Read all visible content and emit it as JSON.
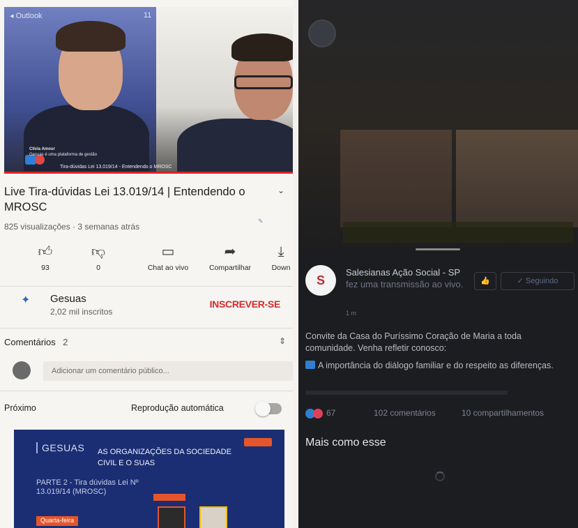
{
  "youtube": {
    "video": {
      "status_app": "◂ Outlook",
      "time": "11",
      "caption_name": "Clívia Amour",
      "caption_text": "Gesuas é uma plataforma de gestão",
      "subtitle": "Tira-dúvidas Lei 13.019/14 - Entendendo o MROSC",
      "progress": 1.0
    },
    "title": "Live Tira-dúvidas Lei 13.019/14 | Entendendo o MROSC",
    "meta": "825 visualizações · 3 semanas atrás",
    "actions": [
      {
        "icon": "thumb-up-icon",
        "glyph": "👍︎",
        "label": "93"
      },
      {
        "icon": "thumb-down-icon",
        "glyph": "👎︎",
        "label": "0"
      },
      {
        "icon": "chat-icon",
        "glyph": "▭",
        "label": "Chat ao vivo"
      },
      {
        "icon": "share-icon",
        "glyph": "➦",
        "label": "Compartilhar"
      },
      {
        "icon": "download-icon",
        "glyph": "⤓",
        "label": "Down"
      }
    ],
    "channel": {
      "name": "Gesuas",
      "subscribers": "2,02 mil inscritos",
      "subscribe_label": "INSCREVER-SE"
    },
    "comments": {
      "label": "Comentários",
      "count": "2",
      "placeholder": "Adicionar um comentário público..."
    },
    "next": {
      "label": "Próximo",
      "autoplay_label": "Reprodução automática",
      "autoplay_on": false
    },
    "thumbnail": {
      "logo": "GESUAS",
      "headline": "AS ORGANIZAÇÕES DA SOCIEDADE CIVIL E O SUAS",
      "part": "PARTE 2 - Tira dúvidas Lei Nº 13.019/14 (MROSC)",
      "date": "Quarta-feira"
    }
  },
  "facebook": {
    "page_name": "Salesianas Ação Social - SP",
    "action_text": "fez uma transmissão ao vivo.",
    "time": "1 m",
    "like_button": "👍",
    "follow_button": "✓ Seguindo",
    "post_text": "Convite da Casa do Puríssimo Coração de Maria a toda comunidade. Venha refletir conosco:",
    "post_item_1": "A importância do diálogo familiar e do respeito as diferenças.",
    "reactions_count": "67",
    "comments_count": "102 comentários",
    "shares_count": "10 compartilhamentos",
    "more_like_this": "Mais como esse",
    "logo_glyph": "S"
  },
  "colors": {
    "youtube_red": "#d42a2a",
    "facebook_dark": "#1c1d20",
    "facebook_blue": "#2f7fd0"
  }
}
